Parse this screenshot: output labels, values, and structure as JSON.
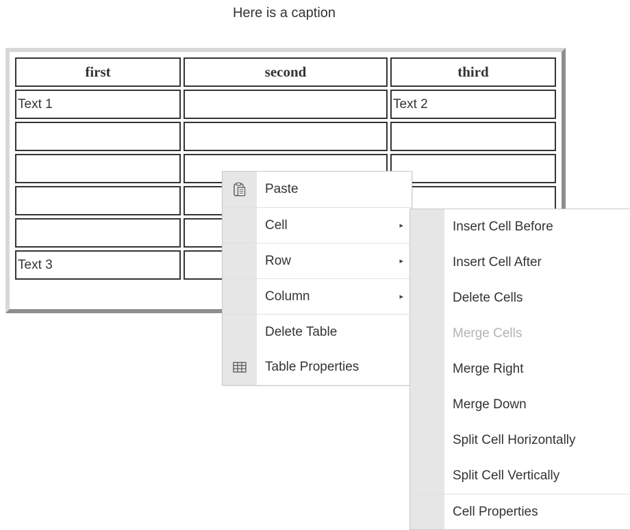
{
  "caption": "Here is a caption",
  "table": {
    "headers": [
      "first",
      "second",
      "third"
    ],
    "rows": [
      [
        "Text 1",
        "",
        "Text 2"
      ],
      [
        "",
        "",
        ""
      ],
      [
        "",
        "",
        ""
      ],
      [
        "",
        "",
        ""
      ],
      [
        "",
        "",
        ""
      ],
      [
        "Text 3",
        "",
        ""
      ]
    ]
  },
  "context_menu": {
    "items": [
      {
        "label": "Paste",
        "icon": "paste-icon"
      },
      {
        "label": "Cell",
        "has_submenu": true
      },
      {
        "label": "Row",
        "has_submenu": true
      },
      {
        "label": "Column",
        "has_submenu": true
      },
      {
        "label": "Delete Table"
      },
      {
        "label": "Table Properties",
        "icon": "table-icon"
      }
    ],
    "submenu_arrow": "▸"
  },
  "cell_submenu": {
    "items": [
      {
        "label": "Insert Cell Before"
      },
      {
        "label": "Insert Cell After"
      },
      {
        "label": "Delete Cells"
      },
      {
        "label": "Merge Cells",
        "disabled": true
      },
      {
        "label": "Merge Right"
      },
      {
        "label": "Merge Down"
      },
      {
        "label": "Split Cell Horizontally"
      },
      {
        "label": "Split Cell Vertically"
      },
      {
        "label": "Cell Properties"
      }
    ]
  },
  "colors": {
    "text": "#333333",
    "disabled_text": "#b3b3b3",
    "gutter": "#e6e6e6",
    "border_dark": "#8e8e8e",
    "border_light": "#d8d8d8"
  }
}
